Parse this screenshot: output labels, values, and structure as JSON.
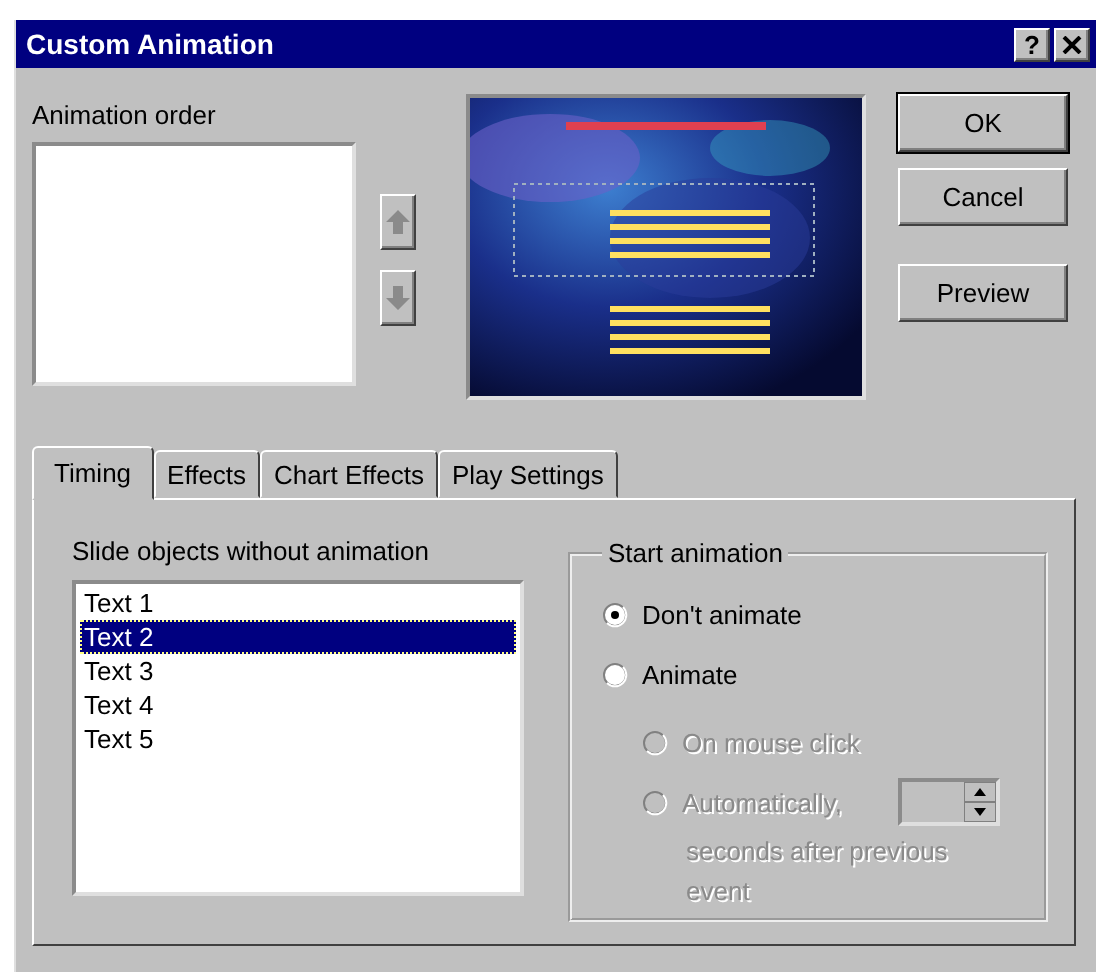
{
  "window": {
    "title": "Custom Animation",
    "help": "?"
  },
  "animation_order": {
    "label": "Animation order"
  },
  "order_buttons": [
    {
      "kind": "up",
      "disabled": true
    },
    {
      "kind": "down",
      "disabled": true
    }
  ],
  "buttons": [
    {
      "label": "OK",
      "default": true
    },
    {
      "label": "Cancel",
      "default": false
    },
    {
      "label": "Preview",
      "default": false
    }
  ],
  "tabs": [
    {
      "label": "Timing",
      "selected": true
    },
    {
      "label": "Effects",
      "selected": false
    },
    {
      "label": "Chart Effects",
      "selected": false
    },
    {
      "label": "Play Settings",
      "selected": false
    }
  ],
  "slide_objects": {
    "label": "Slide objects without animation",
    "items": [
      {
        "label": "Text 1",
        "selected": false
      },
      {
        "label": "Text 2",
        "selected": true
      },
      {
        "label": "Text 3",
        "selected": false
      },
      {
        "label": "Text 4",
        "selected": false
      },
      {
        "label": "Text 5",
        "selected": false
      }
    ]
  },
  "start_animation": {
    "title": "Start animation",
    "options": [
      {
        "label": "Don't animate",
        "selected": true,
        "disabled": false
      },
      {
        "label": "Animate",
        "selected": false,
        "disabled": false,
        "children": [
          {
            "label": "On mouse click",
            "selected": false,
            "disabled": true
          },
          {
            "label": "Automatically,",
            "selected": false,
            "disabled": true,
            "kind": "delay",
            "delay_field": {
              "disabled": true
            },
            "note": "seconds after previous event"
          }
        ]
      }
    ]
  }
}
